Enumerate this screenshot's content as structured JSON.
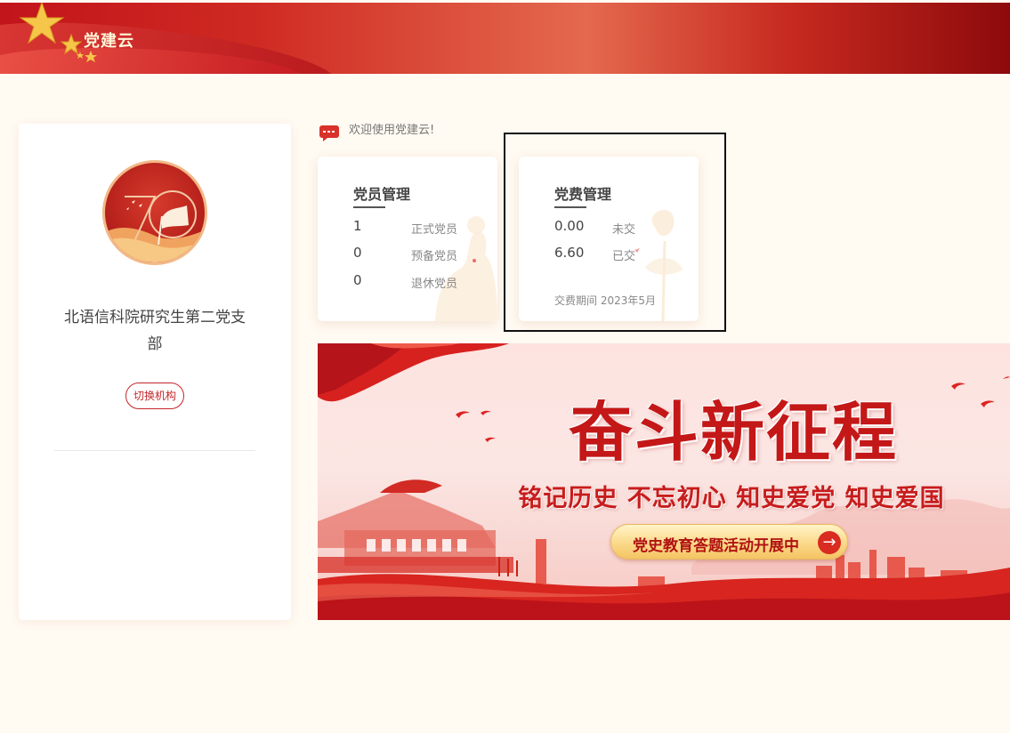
{
  "app": {
    "title": "党建云"
  },
  "org": {
    "name": "北语信科院研究生第二党支部",
    "switch_label": "切换机构"
  },
  "welcome": {
    "text": "欢迎使用党建云!"
  },
  "members_card": {
    "title": "党员管理",
    "rows": [
      {
        "value": "1",
        "label": "正式党员"
      },
      {
        "value": "0",
        "label": "预备党员"
      },
      {
        "value": "0",
        "label": "退休党员"
      }
    ]
  },
  "fees_card": {
    "title": "党费管理",
    "rows": [
      {
        "value": "0.00",
        "label": "未交"
      },
      {
        "value": "6.60",
        "label": "已交"
      }
    ],
    "period_label": "交费期间",
    "period_value": "2023年5月"
  },
  "banner": {
    "title": "奋斗新征程",
    "subtitle": "铭记历史 不忘初心 知史爱党 知史爱国",
    "button_label": "党史教育答题活动开展中"
  },
  "colors": {
    "primary_red": "#c4262a",
    "header_red": "#c2141b",
    "page_background": "#fffaf2"
  }
}
